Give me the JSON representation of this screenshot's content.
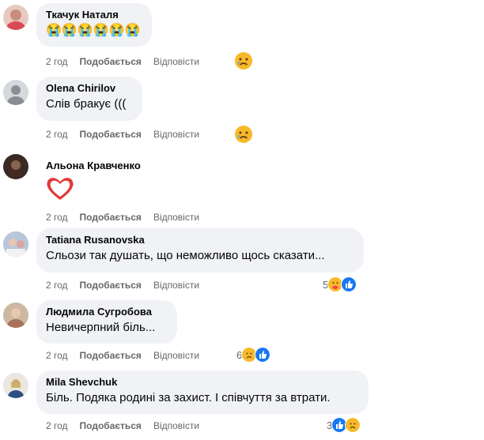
{
  "comments": [
    {
      "author": "Ткачук Наталя",
      "text": "😭😭😭😭😭😭",
      "time": "2 год",
      "like": "Подобається",
      "reply": "Відповісти",
      "reaction_count": ""
    },
    {
      "author": "Olena Chirilov",
      "text": "Слів бракує (((",
      "time": "2 год",
      "like": "Подобається",
      "reply": "Відповісти",
      "reaction_count": ""
    },
    {
      "author": "Альона Кравченко",
      "text": "",
      "time": "2 год",
      "like": "Подобається",
      "reply": "Відповісти",
      "reaction_count": ""
    },
    {
      "author": "Tatiana Rusanovska",
      "text": "Сльози так душать, що неможливо щось сказати...",
      "time": "2 год",
      "like": "Подобається",
      "reply": "Відповісти",
      "reaction_count": "5"
    },
    {
      "author": "Людмила Сугробова",
      "text": "Невичерпний біль...",
      "time": "2 год",
      "like": "Подобається",
      "reply": "Відповісти",
      "reaction_count": "6"
    },
    {
      "author": "Mila Shevchuk",
      "text": "Біль. Подяка родині за захист. І співчуття за втрати.",
      "time": "2 год",
      "like": "Подобається",
      "reply": "Відповісти",
      "reaction_count": "3"
    }
  ],
  "colors": {
    "bubble": "#f0f2f5",
    "meta": "#65676b",
    "like_blue": "#1877f2",
    "sad_yellow": "#f7b928"
  },
  "icons": [
    "sad-reaction-icon",
    "care-reaction-icon",
    "like-reaction-icon",
    "white-heart-emoji"
  ]
}
